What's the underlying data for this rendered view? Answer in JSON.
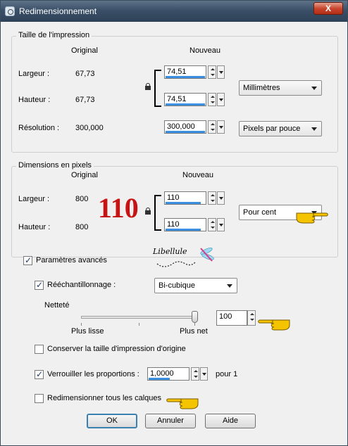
{
  "window": {
    "title": "Redimensionnement",
    "close_label": "X"
  },
  "print": {
    "group_title": "Taille de l'impression",
    "col_original": "Original",
    "col_new": "Nouveau",
    "width_label": "Largeur :",
    "width_original": "67,73",
    "width_new": "74,51",
    "height_label": "Hauteur :",
    "height_original": "67,73",
    "height_new": "74,51",
    "resolution_label": "Résolution :",
    "resolution_original": "300,000",
    "resolution_new": "300,000",
    "unit": "Millimètres",
    "res_unit": "Pixels par pouce"
  },
  "pixels": {
    "group_title": "Dimensions en pixels",
    "col_original": "Original",
    "col_new": "Nouveau",
    "width_label": "Largeur :",
    "width_original": "800",
    "width_new": "110",
    "height_label": "Hauteur :",
    "height_original": "800",
    "height_new": "110",
    "unit": "Pour cent",
    "annotation": "110"
  },
  "advanced": {
    "advanced_label": "Paramètres avancés",
    "advanced_checked": true,
    "resample_label": "Rééchantillonnage :",
    "resample_checked": true,
    "resample_method": "Bi-cubique",
    "sharpness_label": "Netteté",
    "sharpness_min": "Plus lisse",
    "sharpness_max": "Plus net",
    "sharpness_value": "100",
    "sharpness_level": 1.0,
    "keep_print_label": "Conserver la taille d'impression d'origine",
    "keep_print_checked": false,
    "lock_ratio_label": "Verrouiller les proportions :",
    "lock_ratio_checked": true,
    "ratio_value": "1,0000",
    "ratio_suffix": "pour 1",
    "resize_layers_label": "Redimensionner tous les calques",
    "resize_layers_checked": false
  },
  "watermark": "Libellule",
  "buttons": {
    "ok": "OK",
    "cancel": "Annuler",
    "help": "Aide"
  },
  "colors": {
    "accent_bar": "#3b8fe0",
    "annotation_red": "#c61414",
    "pointer_yellow": "#f5c400"
  }
}
